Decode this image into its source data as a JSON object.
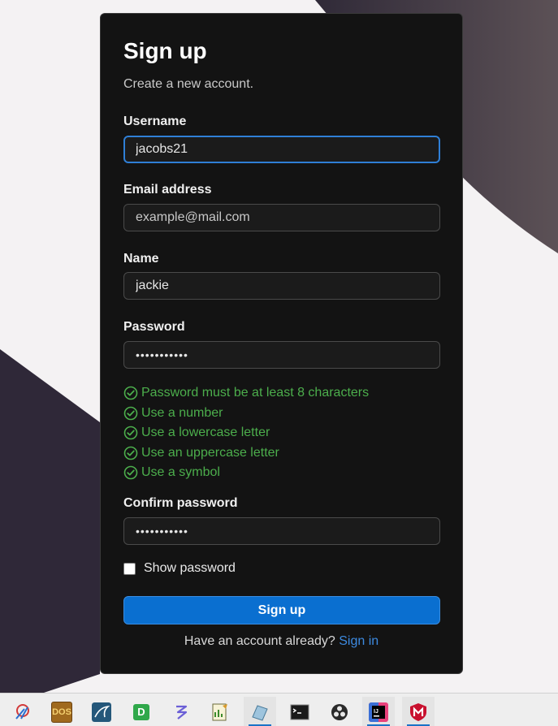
{
  "form": {
    "title": "Sign up",
    "subtitle": "Create a new account.",
    "username": {
      "label": "Username",
      "value": "jacobs21"
    },
    "email": {
      "label": "Email address",
      "placeholder": "example@mail.com"
    },
    "name": {
      "label": "Name",
      "value": "jackie"
    },
    "password": {
      "label": "Password",
      "masked": "•••••••••••"
    },
    "rules": [
      "Password must be at least 8 characters",
      "Use a number",
      "Use a lowercase letter",
      "Use an uppercase letter",
      "Use a symbol"
    ],
    "confirm": {
      "label": "Confirm password",
      "masked": "•••••••••••"
    },
    "show_password": {
      "label": "Show password",
      "checked": false
    },
    "submit_label": "Sign up",
    "footer_text": "Have an account already?",
    "signin_link": "Sign in"
  },
  "colors": {
    "card_bg": "#131313",
    "accent": "#0a6fd0",
    "rule_ok": "#4cae4c",
    "link": "#3d8ae0"
  },
  "taskbar": {
    "items": [
      {
        "icon": "snipping-tool-icon"
      },
      {
        "icon": "dosbox-icon"
      },
      {
        "icon": "mysql-workbench-icon"
      },
      {
        "icon": "d-app-icon"
      },
      {
        "icon": "figma-like-icon"
      },
      {
        "icon": "notepad-chart-icon"
      },
      {
        "icon": "editor-icon",
        "active": true
      },
      {
        "icon": "terminal-icon"
      },
      {
        "icon": "obs-icon"
      },
      {
        "icon": "intellij-icon",
        "active": true
      },
      {
        "icon": "mcafee-icon",
        "active": true
      }
    ]
  }
}
